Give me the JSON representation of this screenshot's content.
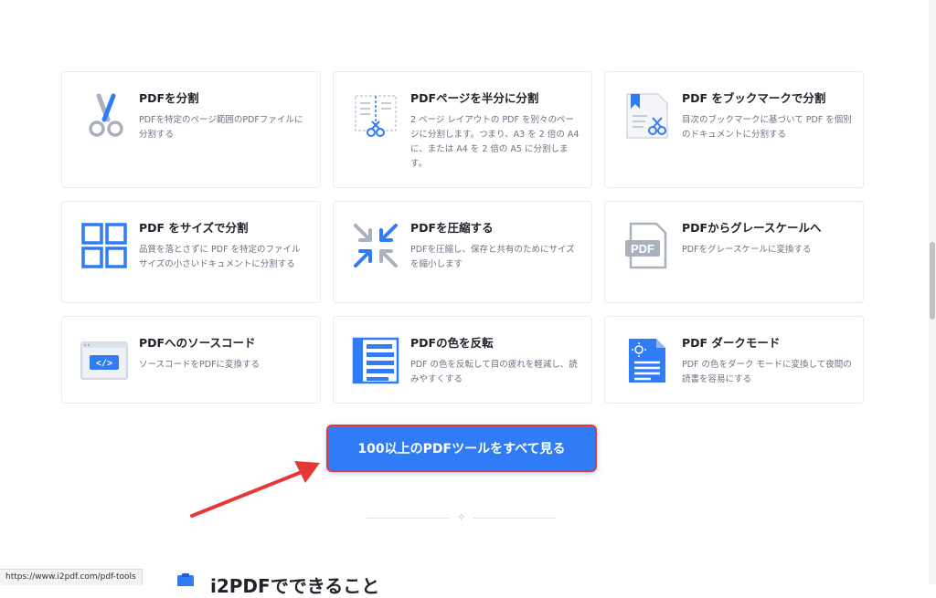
{
  "tools": [
    {
      "title": "PDFを分割",
      "desc": "PDFを特定のページ範囲のPDFファイルに分割する",
      "icon": "scissors-icon"
    },
    {
      "title": "PDFページを半分に分割",
      "desc": "2 ページ レイアウトの PDF を別々のページに分割します。つまり、A3 を 2 倍の A4 に、または A4 を 2 倍の A5 に分割します。",
      "icon": "split-page-half-icon"
    },
    {
      "title": "PDF をブックマークで分割",
      "desc": "目次のブックマークに基づいて PDF を個別のドキュメントに分割する",
      "icon": "bookmark-split-icon"
    },
    {
      "title": "PDF をサイズで分割",
      "desc": "品質を落とさずに PDF を特定のファイル サイズの小さいドキュメントに分割する",
      "icon": "grid-icon"
    },
    {
      "title": "PDFを圧縮する",
      "desc": "PDFを圧縮し、保存と共有のためにサイズを縮小します",
      "icon": "compress-arrows-icon"
    },
    {
      "title": "PDFからグレースケールへ",
      "desc": "PDFをグレースケールに変換する",
      "icon": "pdf-grayscale-icon",
      "icon_text": "PDF"
    },
    {
      "title": "PDFへのソースコード",
      "desc": "ソースコードをPDFに変換する",
      "icon": "source-code-icon",
      "icon_text": "</>"
    },
    {
      "title": "PDFの色を反転",
      "desc": "PDF の色を反転して目の疲れを軽減し、読みやすくする",
      "icon": "invert-color-icon"
    },
    {
      "title": "PDF ダークモード",
      "desc": "PDF の色をダーク モードに変換して夜間の読書を容易にする",
      "icon": "dark-mode-icon"
    }
  ],
  "cta": {
    "label": "100以上のPDFツールをすべて見る"
  },
  "status_bar": {
    "url": "https://www.i2pdf.com/pdf-tools"
  },
  "next_section": {
    "heading": "i2PDFでできること"
  },
  "colors": {
    "accent": "#2f7cf6",
    "cta_border": "#e53935",
    "arrow": "#e53935",
    "icon_gray": "#a9b1bd"
  }
}
